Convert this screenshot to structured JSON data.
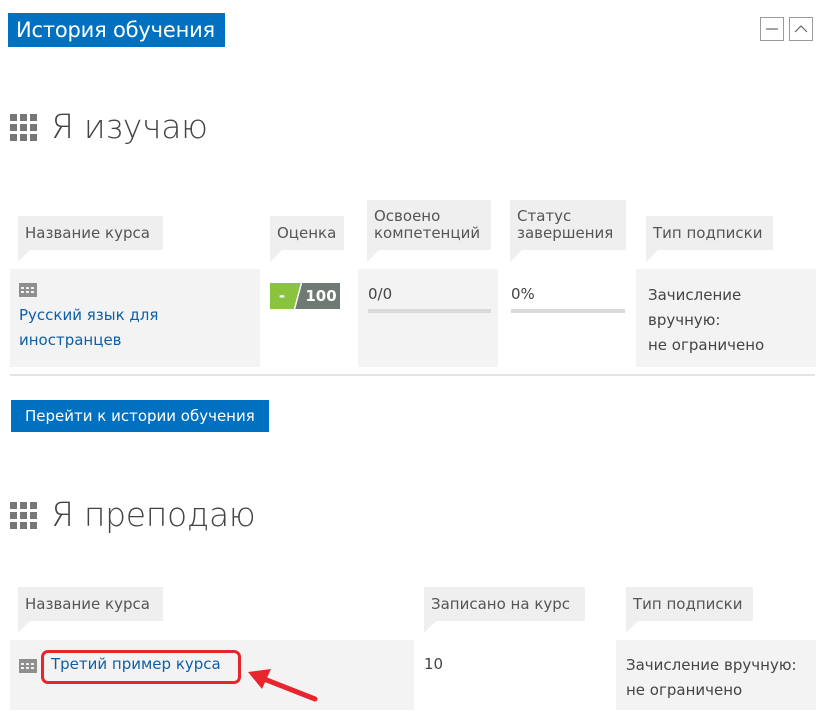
{
  "block": {
    "title": "История обучения",
    "minimize_icon": "minus-icon",
    "collapse_icon": "chevron-up-icon"
  },
  "learning": {
    "title": "Я изучаю",
    "icon": "grid-icon",
    "columns": [
      "Название курса",
      "Оценка",
      "Освоено компетенций",
      "Статус завершения",
      "Тип подписки"
    ],
    "columns_lines": [
      [
        "Название курса"
      ],
      [
        "Оценка"
      ],
      [
        "Освоено",
        "компетенций"
      ],
      [
        "Статус",
        "завершения"
      ],
      [
        "Тип подписки"
      ]
    ],
    "rows": [
      {
        "course_lines": [
          "Русский язык для",
          "иностранцев"
        ],
        "grade_left": "-",
        "grade_right": "100",
        "competencies": "0/0",
        "completion": "0%",
        "subscription_lines": [
          "Зачисление",
          "вручную:",
          "не ограничено"
        ]
      }
    ],
    "history_button": "Перейти к истории обучения"
  },
  "teaching": {
    "title": "Я преподаю",
    "icon": "grid-icon",
    "columns": [
      "Название курса",
      "Записано на курс",
      "Тип подписки"
    ],
    "rows": [
      {
        "course": "Третий пример курса",
        "enrolled": "10",
        "subscription_lines": [
          "Зачисление вручную:",
          "не ограничено"
        ]
      }
    ]
  },
  "colors": {
    "accent": "#0070c0",
    "grade_green": "#8ac43f",
    "grade_gray": "#6e7a73",
    "highlight_red": "#e8242d"
  }
}
